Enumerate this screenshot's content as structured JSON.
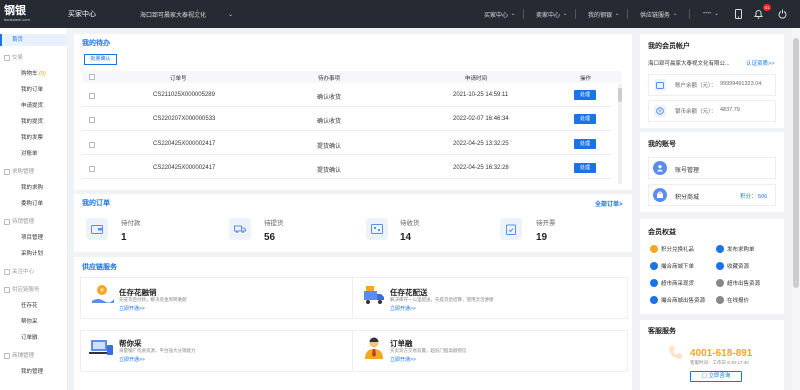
{
  "header": {
    "logo": "钢银",
    "logo_sub": "banksteel.com",
    "center": "买家中心",
    "company": "海口郅可晨家大泰视文化",
    "nav": [
      "买家中心",
      "卖家中心",
      "我的钢银",
      "供应链服务"
    ],
    "user": "••••",
    "badge": "81"
  },
  "sidebar": {
    "home": "首页",
    "groups": [
      {
        "label": "交易",
        "items": [
          "购物车",
          "我的订单",
          "申请提货",
          "我的提货",
          "我的发票",
          "对账单"
        ],
        "cart_count": "(0)"
      },
      {
        "label": "求购管理",
        "items": [
          "我的求购",
          "委购订单"
        ]
      },
      {
        "label": "待销管理",
        "items": [
          "项目管理",
          "采购计划"
        ]
      },
      {
        "label": "关注中心",
        "items": []
      },
      {
        "label": "供应链服务",
        "items": [
          "任存花",
          "帮你采",
          "订单融",
          "我的管理"
        ]
      },
      {
        "label": "商铺管理",
        "items": []
      }
    ]
  },
  "todo": {
    "title": "我的待办",
    "batch_btn": "批量确认",
    "columns": [
      "订单号",
      "待办事项",
      "申请时间",
      "操作"
    ],
    "rows": [
      {
        "order": "CS211025X000005289",
        "task": "确认收货",
        "time": "2021-10-25 14:59:11",
        "action": "处理"
      },
      {
        "order": "CS220207X000000533",
        "task": "确认收货",
        "time": "2022-02-07 16:46:34",
        "action": "处理"
      },
      {
        "order": "CS220425X000002417",
        "task": "提货确认",
        "time": "2022-04-25 13:32:25",
        "action": "处理"
      },
      {
        "order": "CS220425X000002417",
        "task": "提货确认",
        "time": "2022-04-25 16:32:28",
        "action": "处理"
      }
    ]
  },
  "orders": {
    "title": "我的订单",
    "all_link": "全部订单>",
    "stats": [
      {
        "label": "待付款",
        "value": "1"
      },
      {
        "label": "待提货",
        "value": "56"
      },
      {
        "label": "待收货",
        "value": "14"
      },
      {
        "label": "待开票",
        "value": "19"
      }
    ]
  },
  "services": {
    "title": "供应链服务",
    "items": [
      {
        "title": "任存花融销",
        "desc": "先提货后付款，解决资金周转难题",
        "link": "立即开通>>"
      },
      {
        "title": "任存花配送",
        "desc": "解决库存一公里配送，先提货后结算，使用灵活便捷",
        "link": "立即开通>>"
      },
      {
        "title": "帮你采",
        "desc": "海量钢厂优质资源，平台强大分销能力",
        "link": "立即开通>>"
      },
      {
        "title": "订单融",
        "desc": "买卖双方交易双赢，超低门槛高额授信",
        "link": "立即开通>>"
      }
    ]
  },
  "account": {
    "title": "我的会员帐户",
    "company": "海口郅可晨家大泰视文化有限公...",
    "verify_link": "认证资质>>",
    "balance_label": "账户余额（元）：",
    "balance": "99999491323.04",
    "coin_label": "银币余额（元）：",
    "coin": "4837.79"
  },
  "my_account": {
    "title": "我的账号",
    "items": [
      {
        "label": "账号管理",
        "value": ""
      },
      {
        "label": "积分商城",
        "value": "积分： 506"
      }
    ]
  },
  "benefits": {
    "title": "会员权益",
    "items": [
      "积分兑换礼品",
      "发布求购单",
      "撮合商城下单",
      "收藏资源",
      "超市商采现货",
      "超市出售资源",
      "撮合商城出售资源",
      "在线报价"
    ],
    "colors": [
      "#f5a623",
      "#1a73e8",
      "#1a73e8",
      "#1a73e8",
      "#1a73e8",
      "#888888",
      "#1a73e8",
      "#888888"
    ]
  },
  "support": {
    "title": "客服服务",
    "phone": "4001-618-891",
    "hours": "客服时间：工作日 8:30-17:30",
    "btn": "立即咨询"
  }
}
